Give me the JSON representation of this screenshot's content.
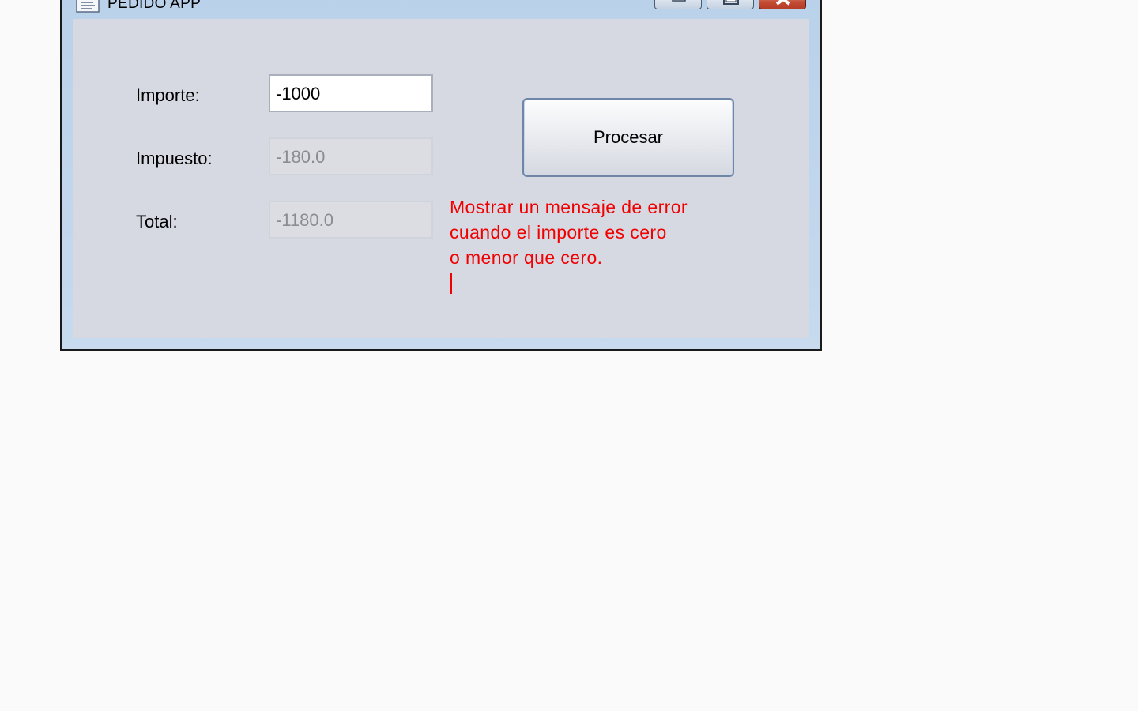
{
  "window": {
    "title": "PEDIDO APP",
    "icons": {
      "app": "app-document-icon",
      "minimize": "minimize-icon",
      "maximize": "maximize-icon",
      "close": "close-icon"
    },
    "colors": {
      "frame": "#b9d1ea",
      "client": "#d6d9e1",
      "close_button": "#c24a33"
    }
  },
  "form": {
    "importe_label": "Importe:",
    "importe_value": "-1000",
    "impuesto_label": "Impuesto:",
    "impuesto_value": "-180.0",
    "total_label": "Total:",
    "total_value": "-1180.0",
    "procesar_label": "Procesar"
  },
  "note": {
    "lines": [
      "Mostrar un mensaje de error",
      "cuando el importe es cero",
      "o menor que cero."
    ],
    "color": "#f00000"
  }
}
